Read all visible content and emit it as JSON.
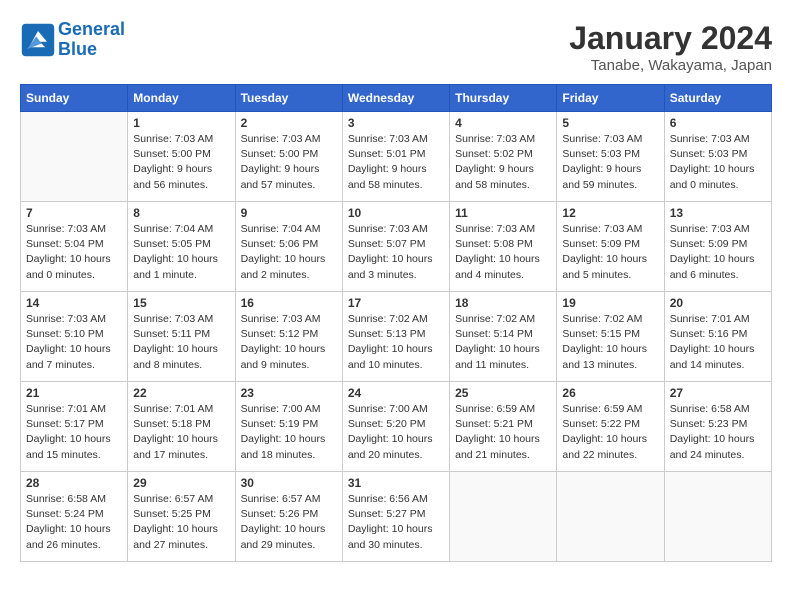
{
  "header": {
    "logo_line1": "General",
    "logo_line2": "Blue",
    "month_title": "January 2024",
    "location": "Tanabe, Wakayama, Japan"
  },
  "weekdays": [
    "Sunday",
    "Monday",
    "Tuesday",
    "Wednesday",
    "Thursday",
    "Friday",
    "Saturday"
  ],
  "weeks": [
    [
      {
        "day": "",
        "sunrise": "",
        "sunset": "",
        "daylight": ""
      },
      {
        "day": "1",
        "sunrise": "Sunrise: 7:03 AM",
        "sunset": "Sunset: 5:00 PM",
        "daylight": "Daylight: 9 hours and 56 minutes."
      },
      {
        "day": "2",
        "sunrise": "Sunrise: 7:03 AM",
        "sunset": "Sunset: 5:00 PM",
        "daylight": "Daylight: 9 hours and 57 minutes."
      },
      {
        "day": "3",
        "sunrise": "Sunrise: 7:03 AM",
        "sunset": "Sunset: 5:01 PM",
        "daylight": "Daylight: 9 hours and 58 minutes."
      },
      {
        "day": "4",
        "sunrise": "Sunrise: 7:03 AM",
        "sunset": "Sunset: 5:02 PM",
        "daylight": "Daylight: 9 hours and 58 minutes."
      },
      {
        "day": "5",
        "sunrise": "Sunrise: 7:03 AM",
        "sunset": "Sunset: 5:03 PM",
        "daylight": "Daylight: 9 hours and 59 minutes."
      },
      {
        "day": "6",
        "sunrise": "Sunrise: 7:03 AM",
        "sunset": "Sunset: 5:03 PM",
        "daylight": "Daylight: 10 hours and 0 minutes."
      }
    ],
    [
      {
        "day": "7",
        "sunrise": "Sunrise: 7:03 AM",
        "sunset": "Sunset: 5:04 PM",
        "daylight": "Daylight: 10 hours and 0 minutes."
      },
      {
        "day": "8",
        "sunrise": "Sunrise: 7:04 AM",
        "sunset": "Sunset: 5:05 PM",
        "daylight": "Daylight: 10 hours and 1 minute."
      },
      {
        "day": "9",
        "sunrise": "Sunrise: 7:04 AM",
        "sunset": "Sunset: 5:06 PM",
        "daylight": "Daylight: 10 hours and 2 minutes."
      },
      {
        "day": "10",
        "sunrise": "Sunrise: 7:03 AM",
        "sunset": "Sunset: 5:07 PM",
        "daylight": "Daylight: 10 hours and 3 minutes."
      },
      {
        "day": "11",
        "sunrise": "Sunrise: 7:03 AM",
        "sunset": "Sunset: 5:08 PM",
        "daylight": "Daylight: 10 hours and 4 minutes."
      },
      {
        "day": "12",
        "sunrise": "Sunrise: 7:03 AM",
        "sunset": "Sunset: 5:09 PM",
        "daylight": "Daylight: 10 hours and 5 minutes."
      },
      {
        "day": "13",
        "sunrise": "Sunrise: 7:03 AM",
        "sunset": "Sunset: 5:09 PM",
        "daylight": "Daylight: 10 hours and 6 minutes."
      }
    ],
    [
      {
        "day": "14",
        "sunrise": "Sunrise: 7:03 AM",
        "sunset": "Sunset: 5:10 PM",
        "daylight": "Daylight: 10 hours and 7 minutes."
      },
      {
        "day": "15",
        "sunrise": "Sunrise: 7:03 AM",
        "sunset": "Sunset: 5:11 PM",
        "daylight": "Daylight: 10 hours and 8 minutes."
      },
      {
        "day": "16",
        "sunrise": "Sunrise: 7:03 AM",
        "sunset": "Sunset: 5:12 PM",
        "daylight": "Daylight: 10 hours and 9 minutes."
      },
      {
        "day": "17",
        "sunrise": "Sunrise: 7:02 AM",
        "sunset": "Sunset: 5:13 PM",
        "daylight": "Daylight: 10 hours and 10 minutes."
      },
      {
        "day": "18",
        "sunrise": "Sunrise: 7:02 AM",
        "sunset": "Sunset: 5:14 PM",
        "daylight": "Daylight: 10 hours and 11 minutes."
      },
      {
        "day": "19",
        "sunrise": "Sunrise: 7:02 AM",
        "sunset": "Sunset: 5:15 PM",
        "daylight": "Daylight: 10 hours and 13 minutes."
      },
      {
        "day": "20",
        "sunrise": "Sunrise: 7:01 AM",
        "sunset": "Sunset: 5:16 PM",
        "daylight": "Daylight: 10 hours and 14 minutes."
      }
    ],
    [
      {
        "day": "21",
        "sunrise": "Sunrise: 7:01 AM",
        "sunset": "Sunset: 5:17 PM",
        "daylight": "Daylight: 10 hours and 15 minutes."
      },
      {
        "day": "22",
        "sunrise": "Sunrise: 7:01 AM",
        "sunset": "Sunset: 5:18 PM",
        "daylight": "Daylight: 10 hours and 17 minutes."
      },
      {
        "day": "23",
        "sunrise": "Sunrise: 7:00 AM",
        "sunset": "Sunset: 5:19 PM",
        "daylight": "Daylight: 10 hours and 18 minutes."
      },
      {
        "day": "24",
        "sunrise": "Sunrise: 7:00 AM",
        "sunset": "Sunset: 5:20 PM",
        "daylight": "Daylight: 10 hours and 20 minutes."
      },
      {
        "day": "25",
        "sunrise": "Sunrise: 6:59 AM",
        "sunset": "Sunset: 5:21 PM",
        "daylight": "Daylight: 10 hours and 21 minutes."
      },
      {
        "day": "26",
        "sunrise": "Sunrise: 6:59 AM",
        "sunset": "Sunset: 5:22 PM",
        "daylight": "Daylight: 10 hours and 22 minutes."
      },
      {
        "day": "27",
        "sunrise": "Sunrise: 6:58 AM",
        "sunset": "Sunset: 5:23 PM",
        "daylight": "Daylight: 10 hours and 24 minutes."
      }
    ],
    [
      {
        "day": "28",
        "sunrise": "Sunrise: 6:58 AM",
        "sunset": "Sunset: 5:24 PM",
        "daylight": "Daylight: 10 hours and 26 minutes."
      },
      {
        "day": "29",
        "sunrise": "Sunrise: 6:57 AM",
        "sunset": "Sunset: 5:25 PM",
        "daylight": "Daylight: 10 hours and 27 minutes."
      },
      {
        "day": "30",
        "sunrise": "Sunrise: 6:57 AM",
        "sunset": "Sunset: 5:26 PM",
        "daylight": "Daylight: 10 hours and 29 minutes."
      },
      {
        "day": "31",
        "sunrise": "Sunrise: 6:56 AM",
        "sunset": "Sunset: 5:27 PM",
        "daylight": "Daylight: 10 hours and 30 minutes."
      },
      {
        "day": "",
        "sunrise": "",
        "sunset": "",
        "daylight": ""
      },
      {
        "day": "",
        "sunrise": "",
        "sunset": "",
        "daylight": ""
      },
      {
        "day": "",
        "sunrise": "",
        "sunset": "",
        "daylight": ""
      }
    ]
  ]
}
